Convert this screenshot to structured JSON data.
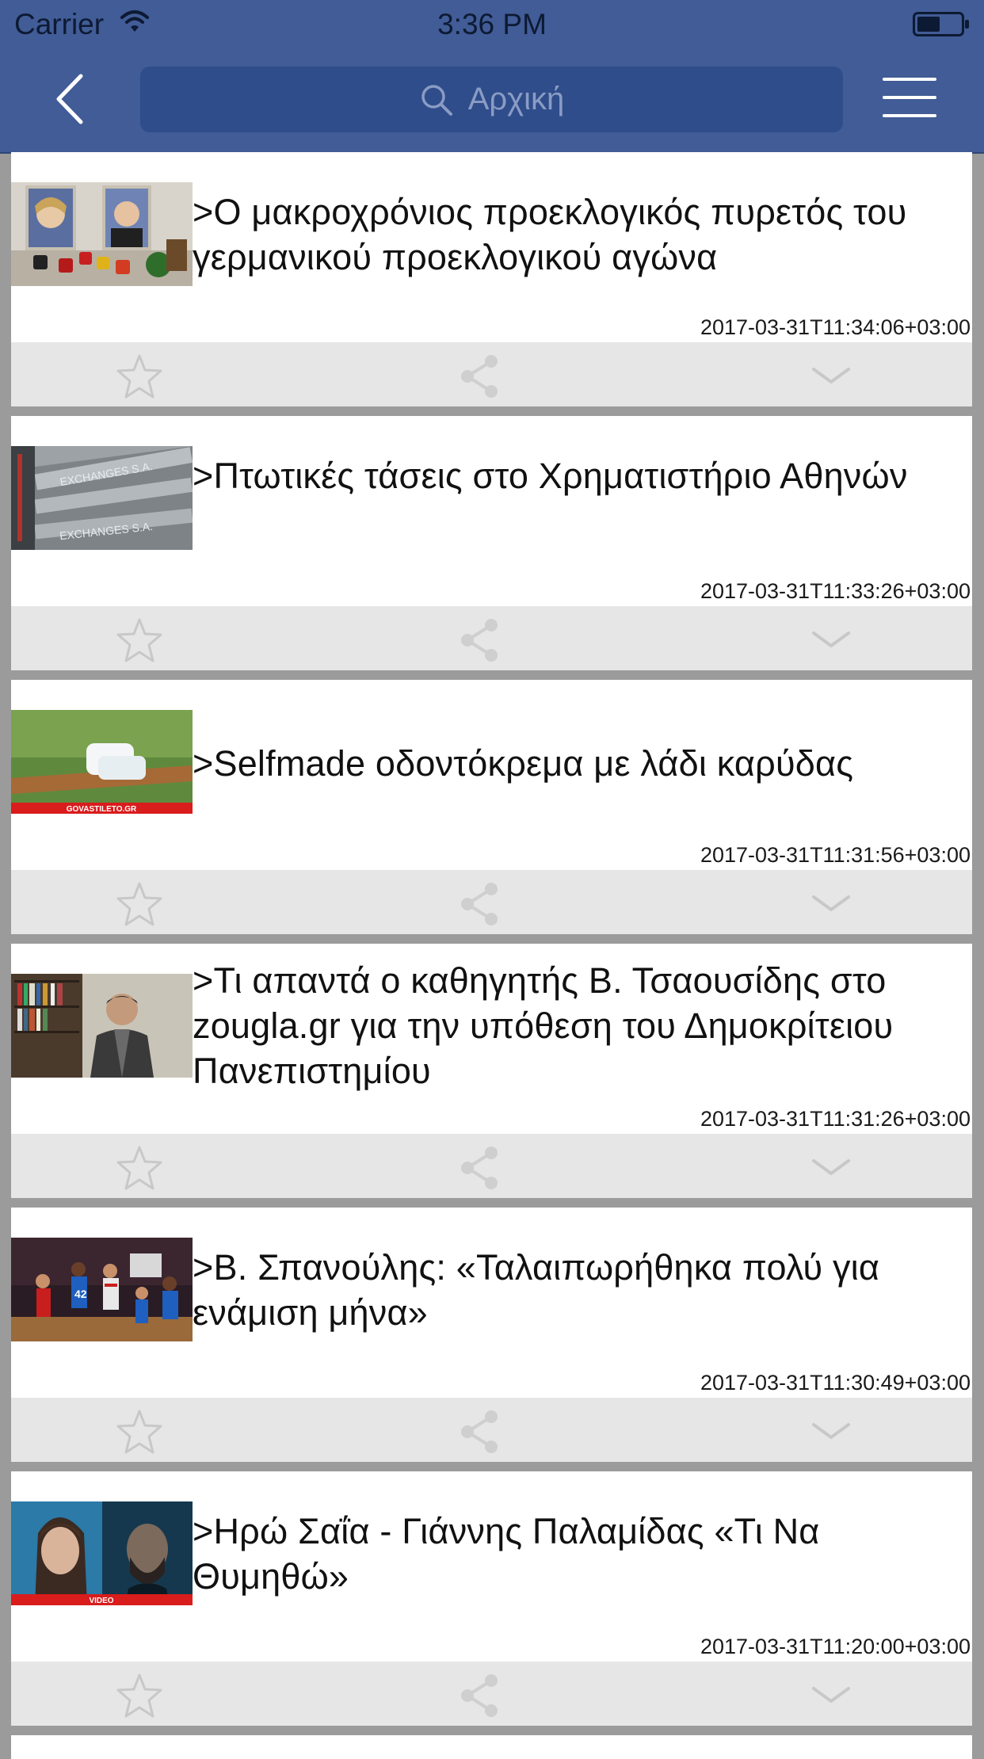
{
  "status_bar": {
    "carrier": "Carrier",
    "time": "3:36 PM"
  },
  "header": {
    "search_placeholder": "Αρχική",
    "back_icon": "chevron-left-icon",
    "menu_icon": "hamburger-menu-icon",
    "color": "#415c96"
  },
  "articles": [
    {
      "title": ">Ο μακροχρόνιος προεκλογικός πυρετός του γερμανικού προεκλογικού αγώνα",
      "date": "2017-03-31T11:34:06+03:00"
    },
    {
      "title": ">Πτωτικές τάσεις στο Χρηματιστήριο Αθηνών",
      "date": "2017-03-31T11:33:26+03:00"
    },
    {
      "title": ">Selfmade οδοντόκρεμα με λάδι καρύδας",
      "date": "2017-03-31T11:31:56+03:00",
      "thumb_caption": "GOVASTILETO.GR"
    },
    {
      "title": ">Τι απαντά ο καθηγητής Β. Τσαουσίδης στο zougla.gr για την υπόθεση του Δημοκρίτειου Πανεπιστημίου",
      "date": "2017-03-31T11:31:26+03:00"
    },
    {
      "title": ">Β. Σπανούλης: «Ταλαιπωρήθηκα πολύ για ενάμιση μήνα»",
      "date": "2017-03-31T11:30:49+03:00"
    },
    {
      "title": ">Ηρώ Σαΐα - Γιάννης Παλαμίδας «Τι Να Θυμηθώ»",
      "date": "2017-03-31T11:20:00+03:00",
      "thumb_caption": "VIDEO"
    }
  ]
}
